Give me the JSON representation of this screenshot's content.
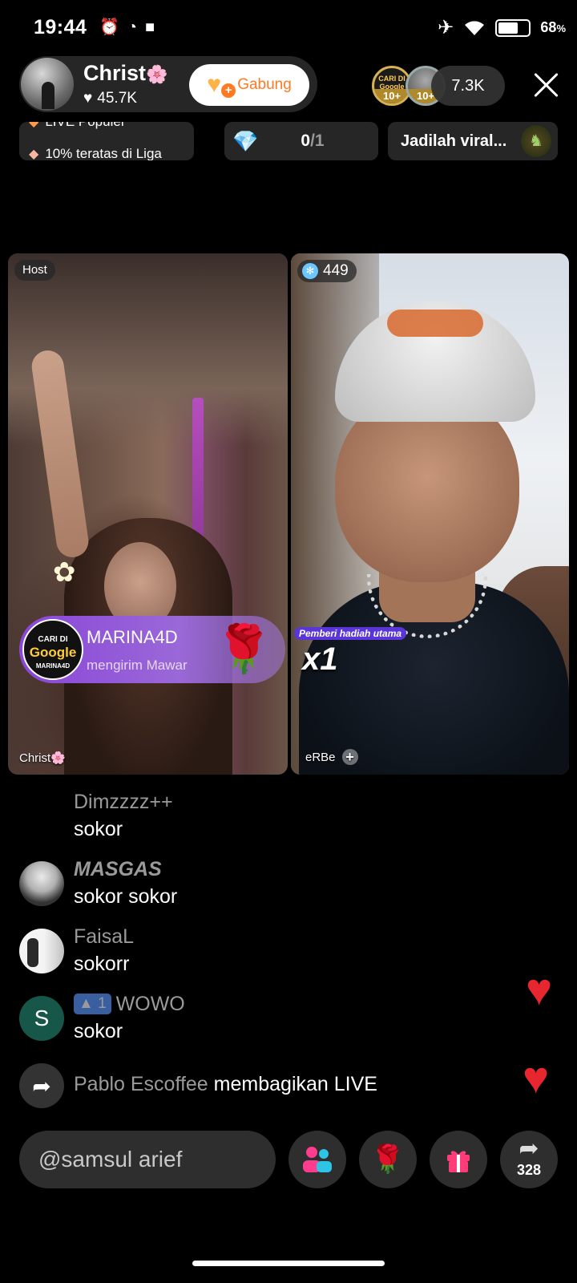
{
  "status_bar": {
    "time": "19:44",
    "battery_pct": "68",
    "battery_unit": "%",
    "battery_level": 0.68,
    "icons": [
      "alarm-icon",
      "sync-icon",
      "video-camera-icon",
      "airplane-icon",
      "wifi-icon",
      "battery-icon"
    ]
  },
  "host": {
    "name": "Christ",
    "name_suffix": "🌸",
    "likes": "45.7K",
    "join_button": "Gabung"
  },
  "viewers": {
    "badges": [
      "10+",
      "10+"
    ],
    "top_viewer_text": [
      "CARI DI",
      "Google"
    ],
    "count": "7.3K"
  },
  "ranking": {
    "line1": "LIVE Populer",
    "line2": "10% teratas di Liga"
  },
  "goal": {
    "current": "0",
    "separator": "/",
    "total": "1"
  },
  "viral": {
    "text": "Jadilah viral..."
  },
  "host_panel": {
    "tag": "Host",
    "name": "Christ",
    "name_suffix": "🌸"
  },
  "guest_panel": {
    "score": "449",
    "top_gifter_label": "Pemberi hadiah utama",
    "top_gifter_mult": "x1",
    "name": "eRBe"
  },
  "gift": {
    "avatar_line1": "CARI DI",
    "avatar_line2": "Google",
    "avatar_line3": "MARINA4D",
    "user": "MARINA4D",
    "action": "mengirim Mawar",
    "gift_icon": "rose-icon"
  },
  "chat": [
    {
      "user": "Dimzzzz++",
      "message": "sokor",
      "avatar": "none"
    },
    {
      "user": "MASGAS",
      "message": "sokor sokor",
      "avatar": "photo"
    },
    {
      "user": "FaisaL",
      "message": "sokorr",
      "avatar": "photo"
    },
    {
      "user": "WOWO",
      "message": "sokor",
      "avatar": "S",
      "level": "1"
    }
  ],
  "share_event": {
    "user": "Pablo Escoffee",
    "action": "membagikan LIVE"
  },
  "bottom_bar": {
    "comment_placeholder": "@samsul arief",
    "share_count": "328"
  },
  "colors": {
    "accent_orange": "#ff7a22",
    "heart_red": "#e8262f",
    "gift_purple": "#8a46d8"
  }
}
